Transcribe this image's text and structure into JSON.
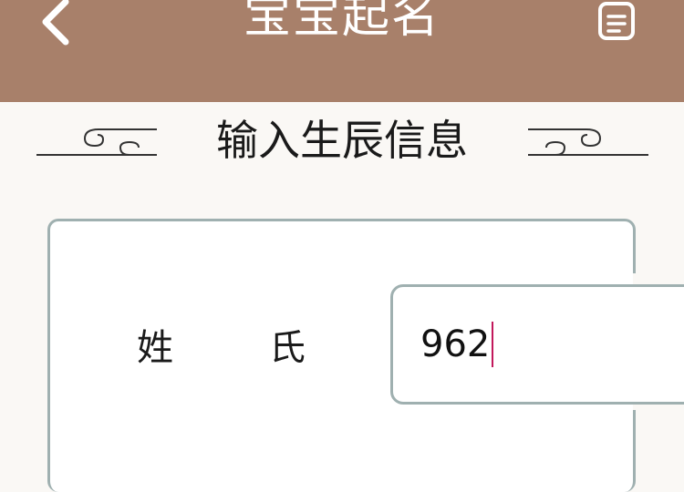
{
  "header": {
    "title": "宝宝起名",
    "background_color": "#a8806a",
    "back_icon": "chevron-left-icon",
    "doc_icon": "clipboard-list-icon"
  },
  "section": {
    "title": "输入生辰信息"
  },
  "form": {
    "surname_label": "姓氏",
    "surname_value": "962"
  }
}
